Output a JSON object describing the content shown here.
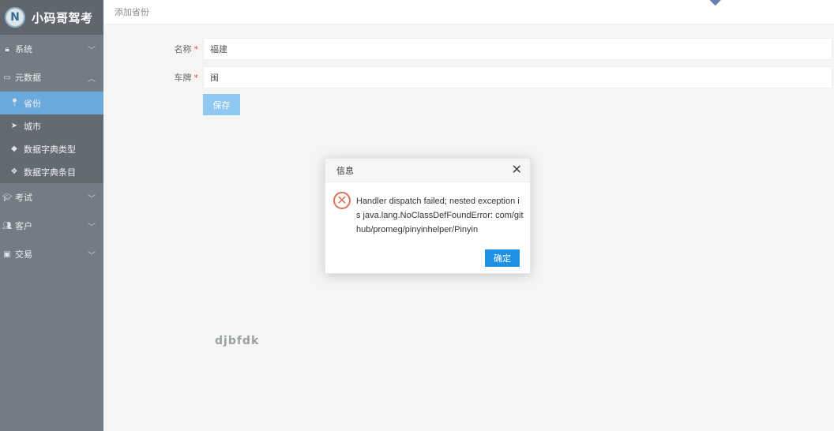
{
  "app": {
    "name": "小码哥驾考",
    "logo_mark": "N"
  },
  "breadcrumb": "添加省份",
  "sidebar": {
    "items": [
      {
        "label": "系统",
        "icon": "lock-icon",
        "glyph": "🔒︎",
        "chevron": "﹀"
      },
      {
        "label": "元数据",
        "icon": "id-card-icon",
        "glyph": "▭",
        "chevron": "︿"
      },
      {
        "label": "考试",
        "icon": "graduation-cap-icon",
        "glyph": "🎓︎",
        "chevron": "﹀"
      },
      {
        "label": "客户",
        "icon": "users-icon",
        "glyph": "👥︎",
        "chevron": "﹀"
      },
      {
        "label": "交易",
        "icon": "money-icon",
        "glyph": "▣",
        "chevron": "﹀"
      }
    ],
    "submenu": [
      {
        "label": "省份",
        "icon": "map-marker-icon",
        "glyph": "📍︎"
      },
      {
        "label": "城市",
        "icon": "location-arrow-icon",
        "glyph": "➤"
      },
      {
        "label": "数据字典类型",
        "icon": "cube-icon",
        "glyph": "◆"
      },
      {
        "label": "数据字典条目",
        "icon": "cubes-icon",
        "glyph": "❖"
      }
    ]
  },
  "form": {
    "name": {
      "label": "名称",
      "required": "*",
      "value": "福建"
    },
    "plate": {
      "label": "车牌",
      "required": "*",
      "value": "闽"
    },
    "save": "保存"
  },
  "dialog": {
    "title": "信息",
    "close": "✕",
    "icon_glyph": "✕",
    "message": "Handler dispatch failed; nested exception is java.lang.NoClassDefFoundError: com/github/promeg/pinyinhelper/Pinyin",
    "ok": "确定"
  },
  "watermark": "djbfdk",
  "colors": {
    "sidebar": "#737b84",
    "active": "#69a9dc",
    "primary": "#1e90e6",
    "error": "#e0705a"
  }
}
